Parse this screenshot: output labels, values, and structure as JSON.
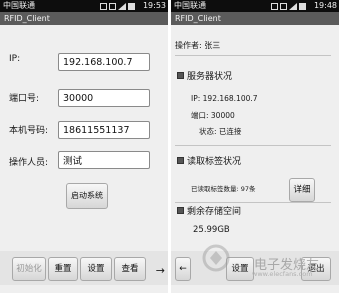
{
  "left_screen": {
    "status": {
      "carrier": "中国联通",
      "time": "19:53"
    },
    "app_title": "RFID_Client",
    "form": {
      "ip_label": "IP:",
      "ip_value": "192.168.100.7",
      "port_label": "端口号:",
      "port_value": "30000",
      "phone_label": "本机号码:",
      "phone_value": "18611551137",
      "operator_label": "操作人员:",
      "operator_value": "测试"
    },
    "start_button": "启动系统",
    "bottom_bar": {
      "init": "初始化",
      "reset": "重置",
      "settings": "设置",
      "view": "查看",
      "more_arrow": "→"
    }
  },
  "right_screen": {
    "status": {
      "carrier": "中国联通",
      "time": "19:48"
    },
    "app_title": "RFID_Client",
    "operator_line": "操作者: 张三",
    "server_section": {
      "title": "服务器状况",
      "ip_line": "IP: 192.168.100.7",
      "port_line": "端口: 30000",
      "state_line": "状态: 已连接"
    },
    "tag_section": {
      "title": "读取标签状况",
      "count_line": "已读取标签数量: 97条",
      "detail_button": "详细"
    },
    "storage_section": {
      "title": "剩余存储空间",
      "value": "25.99GB"
    },
    "bottom_bar": {
      "settings": "设置",
      "exit": "退出"
    },
    "watermark": "电子发烧友",
    "watermark_sub": "www.elecfans.com"
  },
  "colors": {
    "statusbar": "#0d0d0d",
    "titlebar": "#5b5b5b",
    "background": "#efefef",
    "disabled_text": "#9a9a9a"
  }
}
